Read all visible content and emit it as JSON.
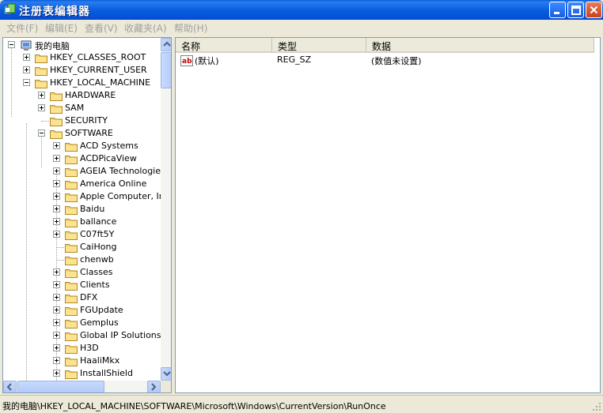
{
  "window": {
    "title": "注册表编辑器"
  },
  "menu": [
    {
      "label": "文件(F)"
    },
    {
      "label": "编辑(E)"
    },
    {
      "label": "查看(V)"
    },
    {
      "label": "收藏夹(A)"
    },
    {
      "label": "帮助(H)"
    }
  ],
  "tree": {
    "root": "我的电脑",
    "hives": [
      "HKEY_CLASSES_ROOT",
      "HKEY_CURRENT_USER",
      "HKEY_LOCAL_MACHINE"
    ],
    "hklm_children": [
      "HARDWARE",
      "SAM",
      "SECURITY",
      "SOFTWARE"
    ],
    "software_children": [
      "ACD Systems",
      "ACDPicaView",
      "AGEIA Technologies",
      "America Online",
      "Apple Computer, Inc",
      "Baidu",
      "ballance",
      "C07ft5Y",
      "CaiHong",
      "chenwb",
      "Classes",
      "Clients",
      "DFX",
      "FGUpdate",
      "Gemplus",
      "Global IP Solutions",
      "H3D",
      "HaaliMkx",
      "InstallShield"
    ]
  },
  "list": {
    "columns": [
      "名称",
      "类型",
      "数据"
    ],
    "rows": [
      {
        "name": "(默认)",
        "type": "REG_SZ",
        "data": "(数值未设置)"
      }
    ]
  },
  "status": {
    "path": "我的电脑\\HKEY_LOCAL_MACHINE\\SOFTWARE\\Microsoft\\Windows\\CurrentVersion\\RunOnce"
  },
  "icons": {
    "app": "regedit-icon",
    "computer": "computer-icon",
    "folder": "folder-icon",
    "string_value": "string-value-icon",
    "minimize": "minimize-icon",
    "maximize": "maximize-icon",
    "close": "close-icon"
  },
  "colors": {
    "titlebar": "#0a5ee0",
    "folder": "#f5d36b",
    "window_bg": "#ece9d8",
    "menu_disabled": "#a0a0a0"
  }
}
